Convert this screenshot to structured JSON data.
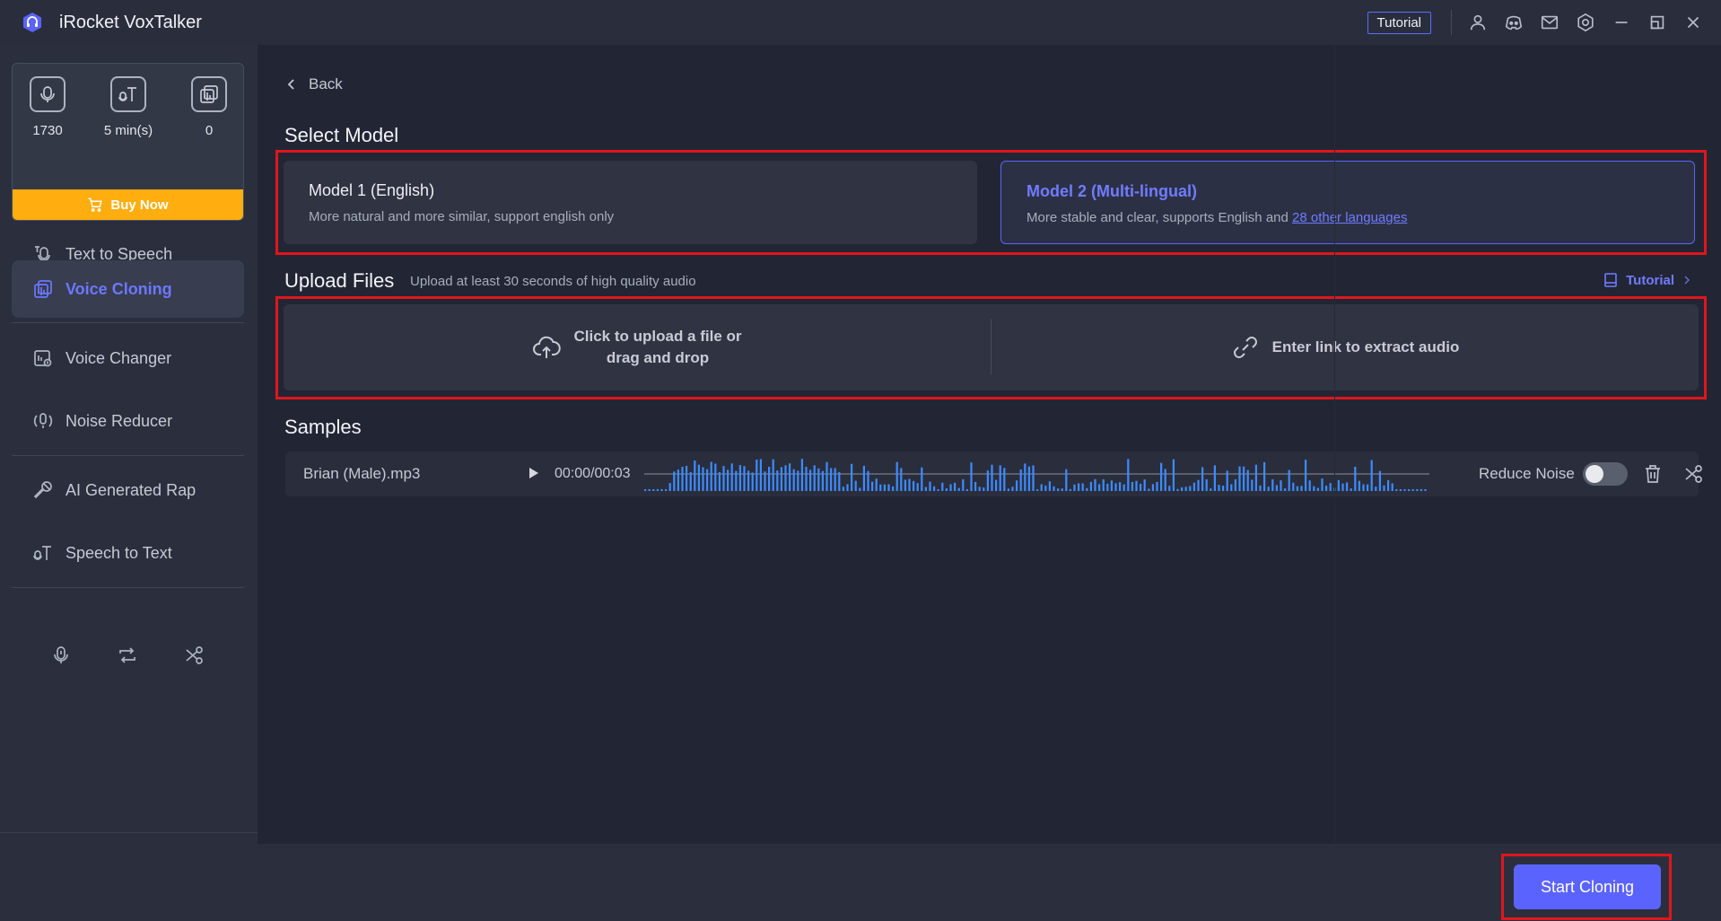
{
  "app": {
    "title": "iRocket VoxTalker"
  },
  "titlebar": {
    "tutorial_label": "Tutorial",
    "icons": [
      "user-icon",
      "discord-icon",
      "mail-icon",
      "settings-icon",
      "minimize-icon",
      "restore-icon",
      "close-icon"
    ]
  },
  "credits": {
    "items": [
      {
        "icon": "tts-credit-icon",
        "value": "1730"
      },
      {
        "icon": "stt-credit-icon",
        "value": "5 min(s)"
      },
      {
        "icon": "clone-credit-icon",
        "value": "0"
      }
    ],
    "buy_label": "Buy Now",
    "buy_color": "#ffad0f"
  },
  "sidebar": {
    "items": [
      {
        "label": "Text to Speech",
        "icon": "text-to-speech-icon"
      },
      {
        "label": "Voice Cloning",
        "icon": "voice-cloning-icon",
        "active": true
      },
      {
        "label": "Voice Changer",
        "icon": "voice-changer-icon"
      },
      {
        "label": "Noise Reducer",
        "icon": "noise-reducer-icon"
      },
      {
        "label": "AI Generated Rap",
        "icon": "microphone-rap-icon"
      },
      {
        "label": "Speech to Text",
        "icon": "speech-to-text-icon"
      }
    ],
    "tools": [
      "record-icon",
      "convert-icon",
      "cut-icon"
    ]
  },
  "main": {
    "back_label": "Back",
    "select_model_title": "Select Model",
    "models": [
      {
        "title": "Model 1 (English)",
        "desc": "More natural and more similar, support english only"
      },
      {
        "title": "Model 2 (Multi-lingual)",
        "desc": "More stable and clear, supports English and ",
        "link": "28 other languages",
        "selected": true
      }
    ],
    "upload_title": "Upload Files",
    "upload_subtitle": "Upload at least 30 seconds of high quality audio",
    "tutorial_label": "Tutorial",
    "upload_click_line1": "Click to upload a file or",
    "upload_click_line2": "drag and drop",
    "upload_link_label": "Enter link to extract audio",
    "samples_title": "Samples",
    "sample": {
      "name": "Brian (Male).mp3",
      "time": "00:00/00:03",
      "reduce_noise_label": "Reduce Noise",
      "reduce_noise_on": false
    }
  },
  "footer": {
    "start_label": "Start Cloning",
    "accent": "#5b63ff"
  },
  "colors": {
    "accent": "#6f7cff",
    "highlight": "#e0161c",
    "wave": "#3d8bff"
  }
}
